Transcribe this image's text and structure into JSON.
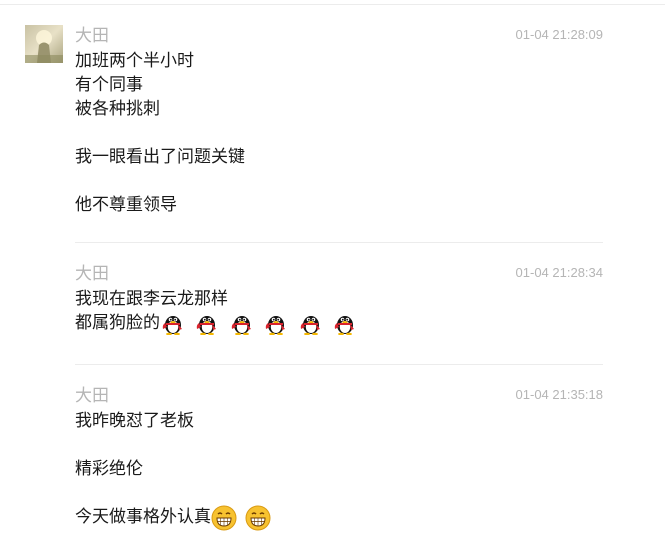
{
  "messages": [
    {
      "sender": "大田",
      "time": "01-04 21:28:09",
      "lines": [
        "加班两个半小时",
        "有个同事",
        "被各种挑刺",
        "",
        "我一眼看出了问题关键",
        "",
        "他不尊重领导"
      ]
    },
    {
      "sender": "大田",
      "time": "01-04 21:28:34",
      "lines": [
        "我现在跟李云龙那样",
        "都属狗脸的"
      ],
      "emoji_after_last_line": [
        "qq-penguin-icon",
        "qq-penguin-icon",
        "qq-penguin-icon",
        "qq-penguin-icon",
        "qq-penguin-icon",
        "qq-penguin-icon"
      ]
    },
    {
      "sender": "大田",
      "time": "01-04 21:35:18",
      "lines": [
        "我昨晚怼了老板",
        "",
        "精彩绝伦",
        "",
        "今天做事格外认真"
      ],
      "emoji_after_last_line": [
        "grin-face-icon",
        "grin-face-icon"
      ]
    }
  ],
  "colors": {
    "sender": "#b5b5b5",
    "time": "#b5b5b5",
    "text": "#1a1a1a",
    "divider": "#ececec"
  }
}
